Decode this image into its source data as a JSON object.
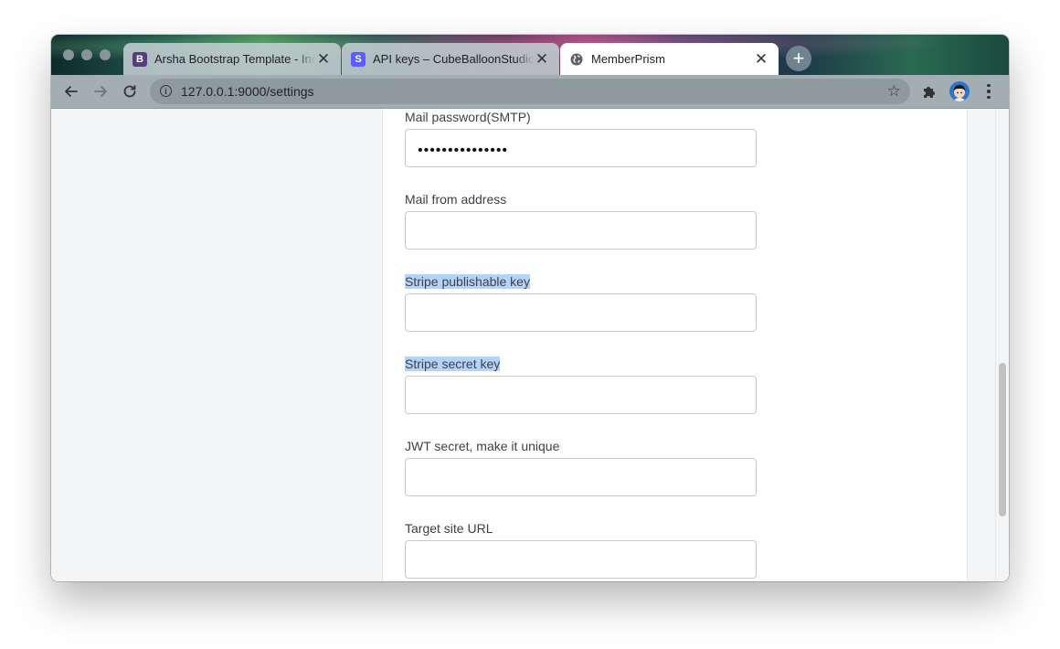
{
  "browser": {
    "tabs": [
      {
        "favicon": "B",
        "title": "Arsha Bootstrap Template - Index",
        "close": "✕"
      },
      {
        "favicon": "S",
        "title": "API keys – CubeBalloonStudio – Stripe",
        "close": "✕"
      },
      {
        "favicon_icon": "globe-icon",
        "title": "MemberPrism",
        "close": "✕"
      }
    ],
    "new_tab": "+",
    "address": "127.0.0.1:9000/settings",
    "address_info": "i",
    "bookmark": "☆"
  },
  "form": {
    "fields": [
      {
        "label": "Mail password(SMTP)",
        "value": "•••••••••••••••",
        "highlighted": false
      },
      {
        "label": "Mail from address",
        "value": "",
        "highlighted": false
      },
      {
        "label": "Stripe publishable key",
        "value": "",
        "highlighted": true
      },
      {
        "label": "Stripe secret key",
        "value": "",
        "highlighted": true
      },
      {
        "label": "JWT secret, make it unique",
        "value": "",
        "highlighted": false
      },
      {
        "label": "Target site URL",
        "value": "",
        "highlighted": false
      }
    ]
  },
  "colors": {
    "selection_highlight": "#b3d3fa",
    "page_background": "#f4f5f7",
    "stripe_brand": "#635bff",
    "bootstrap_brand": "#563d7c"
  }
}
